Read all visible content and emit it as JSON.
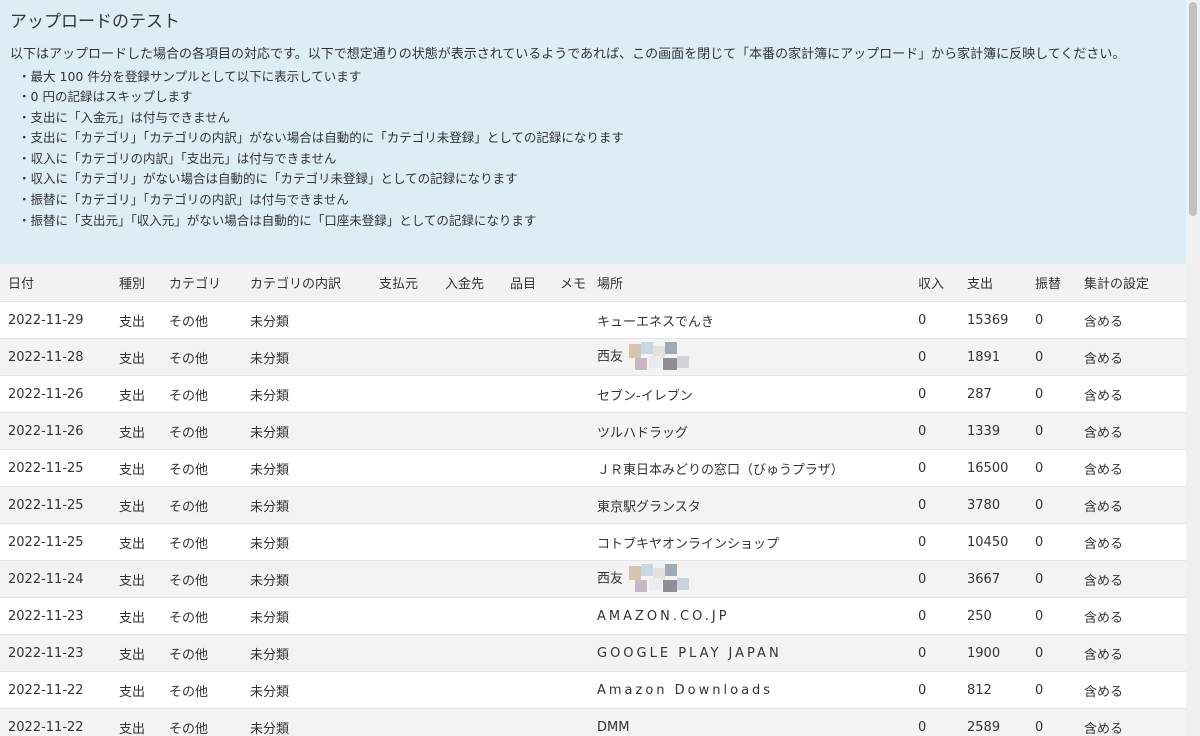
{
  "info": {
    "title": "アップロードのテスト",
    "description": "以下はアップロードした場合の各項目の対応です。以下で想定通りの状態が表示されているようであれば、この画面を閉じて「本番の家計簿にアップロード」から家計簿に反映してください。",
    "notes": [
      "最大 100 件分を登録サンプルとして以下に表示しています",
      "0 円の記録はスキップします",
      "支出に「入金元」は付与できません",
      "支出に「カテゴリ」「カテゴリの内訳」がない場合は自動的に「カテゴリ未登録」としての記録になります",
      "収入に「カテゴリの内訳」「支出元」は付与できません",
      "収入に「カテゴリ」がない場合は自動的に「カテゴリ未登録」としての記録になります",
      "振替に「カテゴリ」「カテゴリの内訳」は付与できません",
      "振替に「支出元」「収入元」がない場合は自動的に「口座未登録」としての記録になります"
    ]
  },
  "table": {
    "headers": [
      "日付",
      "種別",
      "カテゴリ",
      "カテゴリの内訳",
      "支払元",
      "入金先",
      "品目",
      "メモ",
      "場所",
      "収入",
      "支出",
      "振替",
      "集計の設定"
    ],
    "rows": [
      {
        "date": "2022-11-29",
        "type": "支出",
        "category": "その他",
        "subcategory": "未分類",
        "from": "",
        "to": "",
        "item": "",
        "memo": "",
        "place": "キューエネスでんき",
        "income": "0",
        "expense": "15369",
        "transfer": "0",
        "setting": "含める"
      },
      {
        "date": "2022-11-28",
        "type": "支出",
        "category": "その他",
        "subcategory": "未分類",
        "from": "",
        "to": "",
        "item": "",
        "memo": "",
        "place": "西友",
        "income": "0",
        "expense": "1891",
        "transfer": "0",
        "setting": "含める"
      },
      {
        "date": "2022-11-26",
        "type": "支出",
        "category": "その他",
        "subcategory": "未分類",
        "from": "",
        "to": "",
        "item": "",
        "memo": "",
        "place": "セブン-イレブン",
        "income": "0",
        "expense": "287",
        "transfer": "0",
        "setting": "含める"
      },
      {
        "date": "2022-11-26",
        "type": "支出",
        "category": "その他",
        "subcategory": "未分類",
        "from": "",
        "to": "",
        "item": "",
        "memo": "",
        "place": "ツルハドラッグ",
        "income": "0",
        "expense": "1339",
        "transfer": "0",
        "setting": "含める"
      },
      {
        "date": "2022-11-25",
        "type": "支出",
        "category": "その他",
        "subcategory": "未分類",
        "from": "",
        "to": "",
        "item": "",
        "memo": "",
        "place": "ＪＲ東日本みどりの窓口（びゅうプラザ）",
        "income": "0",
        "expense": "16500",
        "transfer": "0",
        "setting": "含める"
      },
      {
        "date": "2022-11-25",
        "type": "支出",
        "category": "その他",
        "subcategory": "未分類",
        "from": "",
        "to": "",
        "item": "",
        "memo": "",
        "place": "東京駅グランスタ",
        "income": "0",
        "expense": "3780",
        "transfer": "0",
        "setting": "含める"
      },
      {
        "date": "2022-11-25",
        "type": "支出",
        "category": "その他",
        "subcategory": "未分類",
        "from": "",
        "to": "",
        "item": "",
        "memo": "",
        "place": "コトブキヤオンラインショップ",
        "income": "0",
        "expense": "10450",
        "transfer": "0",
        "setting": "含める"
      },
      {
        "date": "2022-11-24",
        "type": "支出",
        "category": "その他",
        "subcategory": "未分類",
        "from": "",
        "to": "",
        "item": "",
        "memo": "",
        "place": "西友",
        "income": "0",
        "expense": "3667",
        "transfer": "0",
        "setting": "含める"
      },
      {
        "date": "2022-11-23",
        "type": "支出",
        "category": "その他",
        "subcategory": "未分類",
        "from": "",
        "to": "",
        "item": "",
        "memo": "",
        "place": "AMAZON.CO.JP",
        "income": "0",
        "expense": "250",
        "transfer": "0",
        "setting": "含める"
      },
      {
        "date": "2022-11-23",
        "type": "支出",
        "category": "その他",
        "subcategory": "未分類",
        "from": "",
        "to": "",
        "item": "",
        "memo": "",
        "place": "GOOGLE PLAY JAPAN",
        "income": "0",
        "expense": "1900",
        "transfer": "0",
        "setting": "含める"
      },
      {
        "date": "2022-11-22",
        "type": "支出",
        "category": "その他",
        "subcategory": "未分類",
        "from": "",
        "to": "",
        "item": "",
        "memo": "",
        "place": "Amazon Downloads",
        "income": "0",
        "expense": "812",
        "transfer": "0",
        "setting": "含める"
      },
      {
        "date": "2022-11-22",
        "type": "支出",
        "category": "その他",
        "subcategory": "未分類",
        "from": "",
        "to": "",
        "item": "",
        "memo": "",
        "place": "DMM",
        "income": "0",
        "expense": "2589",
        "transfer": "0",
        "setting": "含める"
      }
    ]
  }
}
